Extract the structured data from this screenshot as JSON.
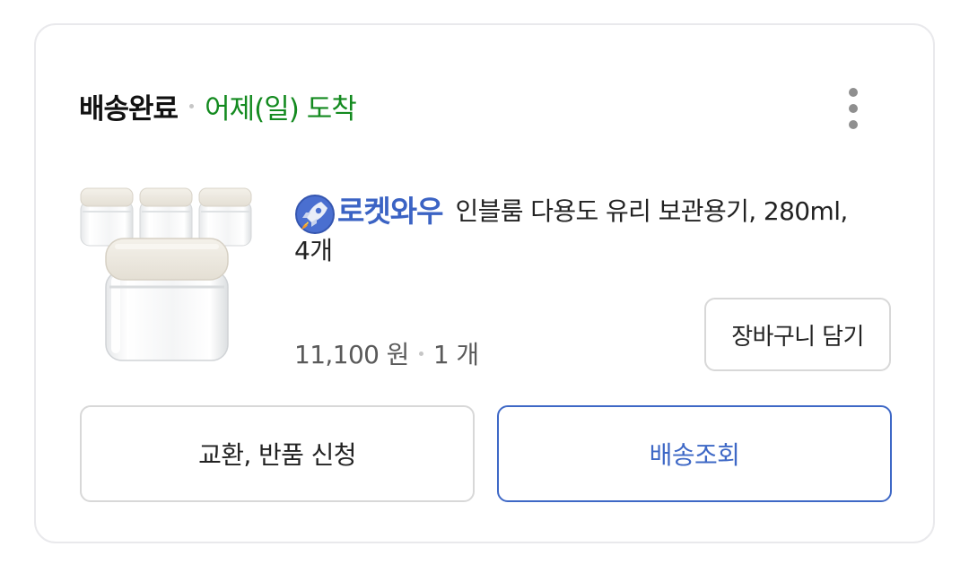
{
  "order": {
    "status": "배송완료",
    "arrival": "어제(일) 도착"
  },
  "icons": {
    "more": "more-vertical-icon",
    "badge": "rocket-icon"
  },
  "product": {
    "badge": "로켓와우",
    "name_line1": "인블룸 다용도 유리 보관용기, 280ml,",
    "name_line2": "4개",
    "price": "11,100 원",
    "quantity": "1 개",
    "image": "glass-jars-product-image"
  },
  "buttons": {
    "cart": "장바구니 담기",
    "exchange": "교환, 반품 신청",
    "track": "배송조회"
  },
  "colors": {
    "arrival": "#138a1f",
    "badge": "#3b63c4",
    "track_accent": "#3e68c6",
    "border": "#d8d8d8"
  }
}
